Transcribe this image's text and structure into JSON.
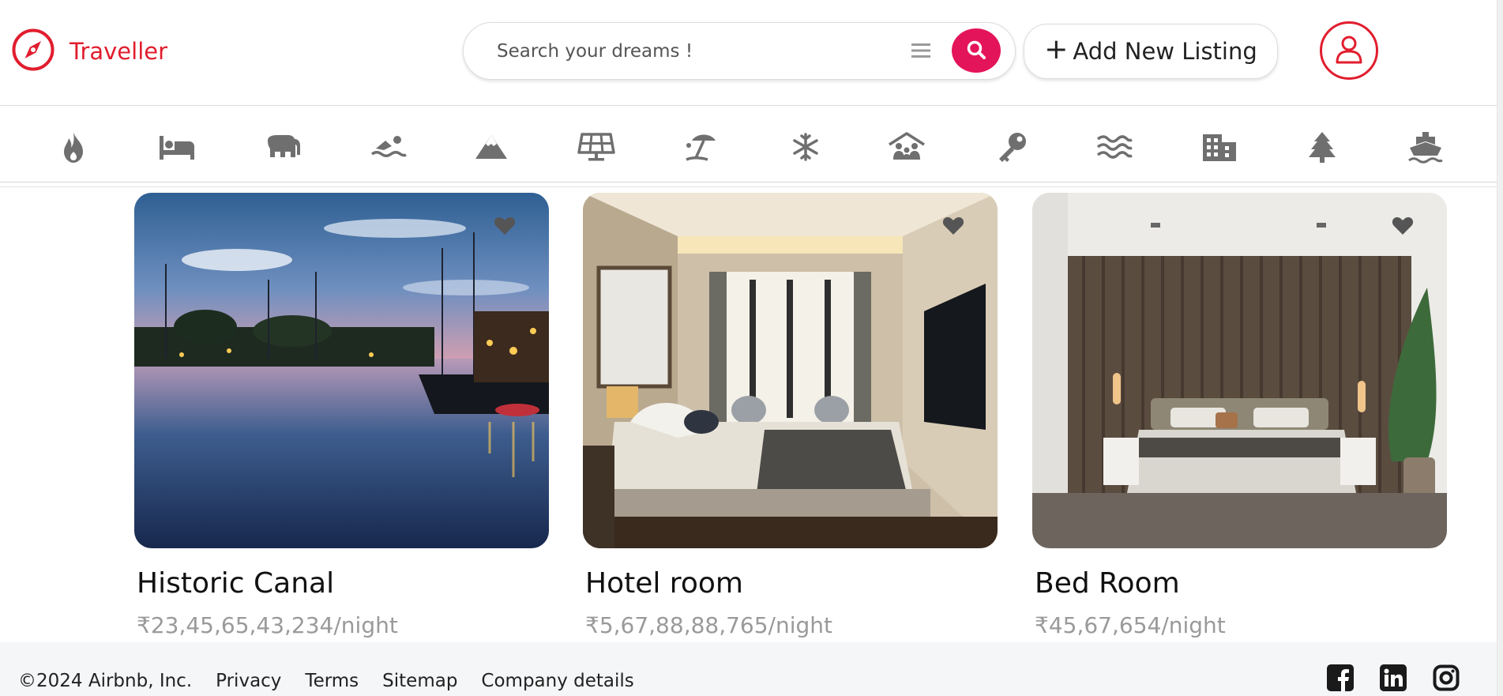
{
  "header": {
    "brand": {
      "name": "Traveller",
      "icon": "compass-icon"
    },
    "search": {
      "placeholder": "Search your dreams !"
    },
    "add_listing_label": "Add New Listing",
    "add_listing_icon": "plus-icon",
    "profile_icon": "user-icon"
  },
  "colors": {
    "brand": "#e11d2e",
    "search_button": "#e4145a",
    "icons": "#6f6f6f"
  },
  "filters": [
    "fire-icon",
    "bed-icon",
    "elephant-icon",
    "swimmer-icon",
    "mountain-icon",
    "solar-panel-icon",
    "beach-umbrella-icon",
    "snowflake-icon",
    "house-people-icon",
    "key-icon",
    "waves-icon",
    "city-icon",
    "tree-icon",
    "ship-icon"
  ],
  "listings": [
    {
      "title": "Historic Canal",
      "price": "₹23,45,65,43,234/night",
      "image": "harbor-at-dusk"
    },
    {
      "title": "Hotel room",
      "price": "₹5,67,88,88,765/night",
      "image": "hotel-bedroom"
    },
    {
      "title": "Bed Room",
      "price": "₹45,67,654/night",
      "image": "modern-bedroom"
    }
  ],
  "footer": {
    "copyright": "©2024 Airbnb, Inc.",
    "links": [
      "Privacy",
      "Terms",
      "Sitemap",
      "Company details"
    ],
    "socials": [
      "facebook-icon",
      "linkedin-icon",
      "instagram-icon"
    ]
  }
}
